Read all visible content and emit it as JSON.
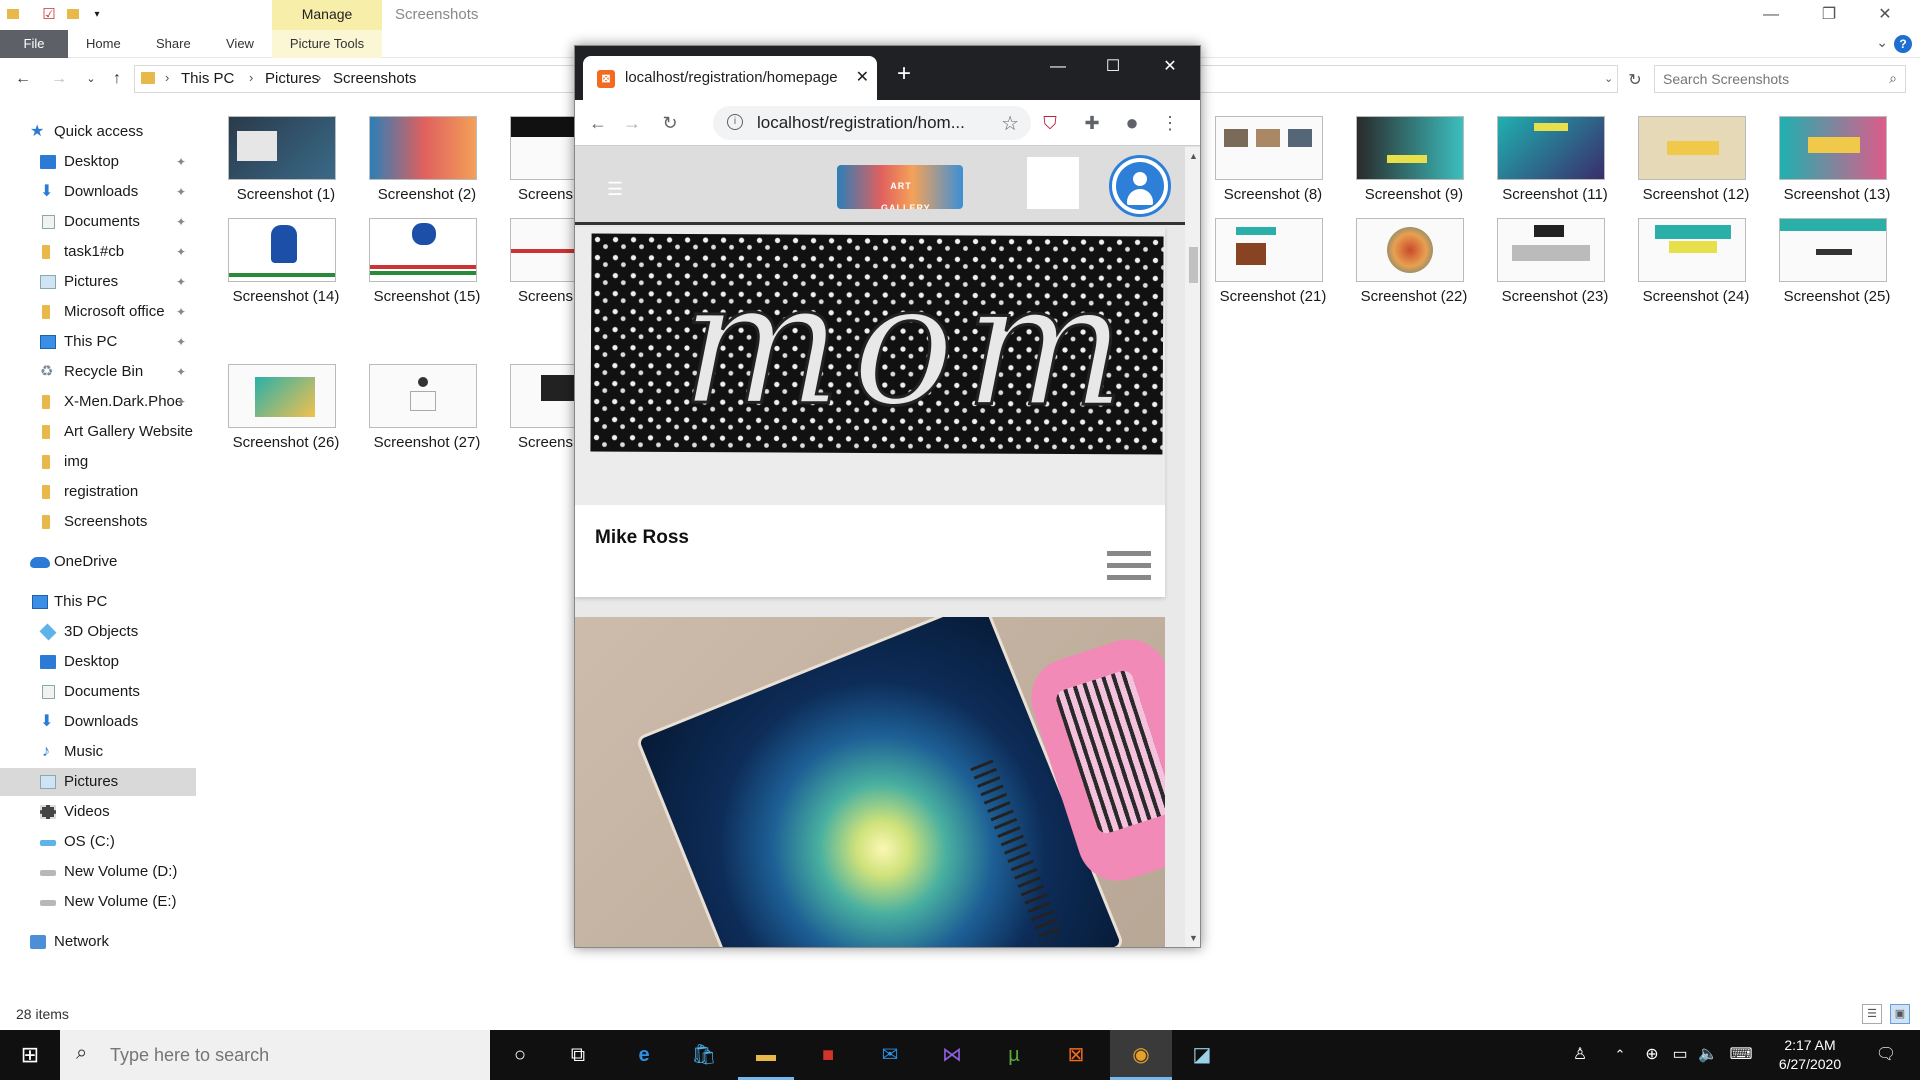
{
  "explorer": {
    "title": "Screenshots",
    "manage_label": "Manage",
    "ribbon_tabs": {
      "file": "File",
      "home": "Home",
      "share": "Share",
      "view": "View",
      "picture_tools": "Picture Tools"
    },
    "breadcrumb": [
      "This PC",
      "Pictures",
      "Screenshots"
    ],
    "search_placeholder": "Search Screenshots",
    "nav": {
      "quick_access": "Quick access",
      "pinned": [
        "Desktop",
        "Downloads",
        "Documents",
        "task1#cb",
        "Pictures",
        "Microsoft office",
        "This PC",
        "Recycle Bin",
        "X-Men.Dark.Phoe"
      ],
      "recent": [
        "Art Gallery Website",
        "img",
        "registration",
        "Screenshots"
      ],
      "onedrive": "OneDrive",
      "this_pc": "This PC",
      "pc_items": [
        "3D Objects",
        "Desktop",
        "Documents",
        "Downloads",
        "Music",
        "Pictures",
        "Videos",
        "OS (C:)",
        "New Volume (D:)",
        "New Volume (E:)"
      ],
      "network": "Network"
    },
    "thumbnails_left": [
      "Screenshot (1)",
      "Screenshot (2)",
      "Screensh",
      "Screenshot (14)",
      "Screenshot (15)",
      "Screensh",
      "Screenshot (26)",
      "Screenshot (27)",
      "Screensh"
    ],
    "thumbnails_right": [
      "Screenshot (8)",
      "Screenshot (9)",
      "Screenshot (11)",
      "Screenshot (12)",
      "Screenshot (13)",
      "Screenshot (21)",
      "Screenshot (22)",
      "Screenshot (23)",
      "Screenshot (24)",
      "Screenshot (25)"
    ],
    "status_items": "28 items"
  },
  "chrome": {
    "tab_title": "localhost/registration/homepage",
    "url": "localhost/registration/hom...",
    "page": {
      "artist_name": "Mike Ross",
      "artwork_word": "mom",
      "logo_text": "ART GALLERY"
    }
  },
  "taskbar": {
    "search_placeholder": "Type here to search",
    "time": "2:17 AM",
    "date": "6/27/2020"
  },
  "colors": {
    "accent_blue": "#2d7fd8",
    "manage_yellow": "#f7eeaa",
    "chrome_dark": "#202124",
    "taskbar": "#101010"
  }
}
